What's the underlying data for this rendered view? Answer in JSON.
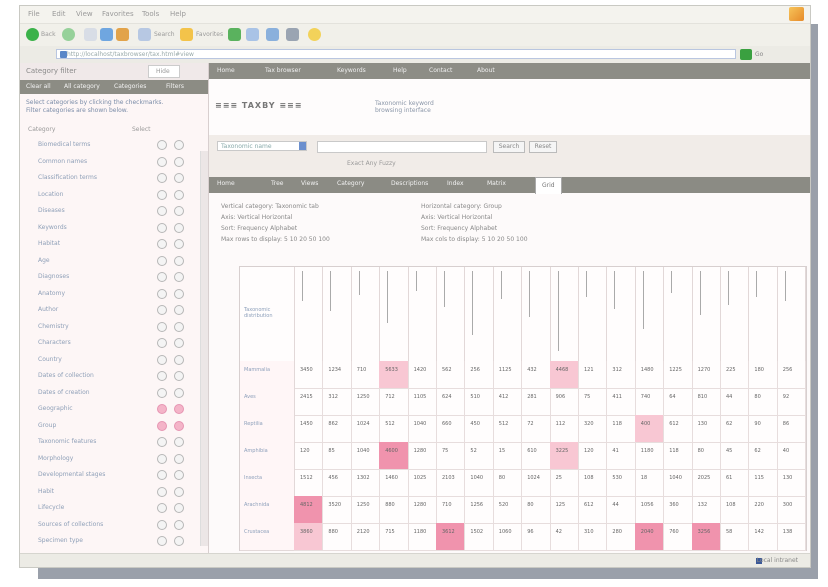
{
  "menubar": {
    "items": [
      "File",
      "Edit",
      "View",
      "Favorites",
      "Tools",
      "Help"
    ]
  },
  "toolbar": {
    "back_label": "Back",
    "search_label": "Search",
    "favorites_label": "Favorites"
  },
  "address": {
    "url": "http://localhost/taxbrowser/tax.html#view",
    "go_label": "Go"
  },
  "sidebar": {
    "title": "Category filter",
    "close_label": "Hide",
    "tabs": [
      "Clear all",
      "All category",
      "Categories",
      "Filters"
    ],
    "note": "Select categories by clicking the checkmarks. Filter categories are shown below.",
    "col_category": "Category",
    "col_select": "Select",
    "items": [
      {
        "label": "Biomedical terms",
        "pink": false
      },
      {
        "label": "Common names",
        "pink": false
      },
      {
        "label": "Classification terms",
        "pink": false
      },
      {
        "label": "Location",
        "pink": false
      },
      {
        "label": "Diseases",
        "pink": false
      },
      {
        "label": "Keywords",
        "pink": false
      },
      {
        "label": "Habitat",
        "pink": false
      },
      {
        "label": "Age",
        "pink": false
      },
      {
        "label": "Diagnoses",
        "pink": false
      },
      {
        "label": "Anatomy",
        "pink": false
      },
      {
        "label": "Author",
        "pink": false
      },
      {
        "label": "Chemistry",
        "pink": false
      },
      {
        "label": "Characters",
        "pink": false
      },
      {
        "label": "Country",
        "pink": false
      },
      {
        "label": "Dates of collection",
        "pink": false
      },
      {
        "label": "Dates of creation",
        "pink": false
      },
      {
        "label": "Geographic",
        "pink": true
      },
      {
        "label": "Group",
        "pink": true
      },
      {
        "label": "Taxonomic features",
        "pink": false
      },
      {
        "label": "Morphology",
        "pink": false
      },
      {
        "label": "Developmental stages",
        "pink": false
      },
      {
        "label": "Habit",
        "pink": false
      },
      {
        "label": "Lifecycle",
        "pink": false
      },
      {
        "label": "Sources of collections",
        "pink": false
      },
      {
        "label": "Specimen type",
        "pink": false
      }
    ]
  },
  "topnav": {
    "items": [
      "Home",
      "Tax browser",
      "Keywords",
      "Help",
      "Contact",
      "About"
    ]
  },
  "logo": {
    "text": "≡≡≡ TAXBY ≡≡≡",
    "sub1": "Taxonomic keyword",
    "sub2": "browsing interface"
  },
  "search": {
    "select_value": "Taxonomic name",
    "submit_label": "Search",
    "reset_label": "Reset",
    "options": "Exact   Any   Fuzzy"
  },
  "tabs": [
    "Home",
    "Tree",
    "Views",
    "Category",
    "Descriptions",
    "Index",
    "Matrix",
    "Grid"
  ],
  "active_tab": "Grid",
  "settings": {
    "left_title": "Vertical category:  Taxonomic tab",
    "left_line1": "Axis:   Vertical   Horizontal",
    "left_line2": "Sort:   Frequency   Alphabet",
    "left_line3": "Max rows to display:   5  10  20  50  100",
    "right_title": "Horizontal category:  Group",
    "right_line1": "Axis:   Vertical   Horizontal",
    "right_line2": "Sort:   Frequency   Alphabet",
    "right_line3": "Max cols to display:   5  10  20  50  100"
  },
  "grid": {
    "corner_label": "Taxonomic distribution",
    "row_labels": [
      "Mammalia",
      "Aves",
      "Reptilia",
      "Amphibia",
      "Insecta",
      "Arachnida",
      "Crustacea"
    ],
    "rows": [
      [
        "3450",
        "1234",
        "710",
        "5633",
        "1420",
        "562",
        "256",
        "1125",
        "432",
        "4468",
        "121",
        "312",
        "1480",
        "1225",
        "1270",
        "225",
        "180",
        "256"
      ],
      [
        "2415",
        "312",
        "1250",
        "712",
        "1105",
        "624",
        "510",
        "412",
        "281",
        "906",
        "75",
        "411",
        "740",
        "64",
        "810",
        "44",
        "80",
        "92"
      ],
      [
        "1450",
        "862",
        "1024",
        "512",
        "1040",
        "660",
        "450",
        "512",
        "72",
        "112",
        "320",
        "118",
        "400",
        "612",
        "130",
        "62",
        "90",
        "86"
      ],
      [
        "120",
        "85",
        "1040",
        "4600",
        "1280",
        "75",
        "52",
        "15",
        "610",
        "3225",
        "120",
        "41",
        "1180",
        "118",
        "80",
        "45",
        "62",
        "40"
      ],
      [
        "1512",
        "456",
        "1302",
        "1460",
        "1025",
        "2103",
        "1040",
        "80",
        "1024",
        "25",
        "108",
        "530",
        "18",
        "1040",
        "2025",
        "61",
        "115",
        "130"
      ],
      [
        "4812",
        "3520",
        "1250",
        "880",
        "1280",
        "710",
        "1256",
        "520",
        "80",
        "125",
        "612",
        "44",
        "1056",
        "360",
        "132",
        "108",
        "220",
        "300"
      ],
      [
        "3860",
        "880",
        "2120",
        "715",
        "1180",
        "3612",
        "1502",
        "1060",
        "96",
        "42",
        "310",
        "280",
        "2040",
        "760",
        "3256",
        "58",
        "142",
        "138"
      ]
    ],
    "highlights": [
      [
        0,
        3,
        "hl1"
      ],
      [
        0,
        9,
        "hl1"
      ],
      [
        3,
        3,
        "hl2"
      ],
      [
        3,
        9,
        "hl1"
      ],
      [
        5,
        0,
        "hl2"
      ],
      [
        6,
        0,
        "hl1"
      ],
      [
        6,
        5,
        "hl2"
      ],
      [
        6,
        12,
        "hl2"
      ],
      [
        6,
        14,
        "hl2"
      ],
      [
        2,
        12,
        "hl1"
      ]
    ]
  },
  "status": {
    "zone": "Local intranet"
  }
}
